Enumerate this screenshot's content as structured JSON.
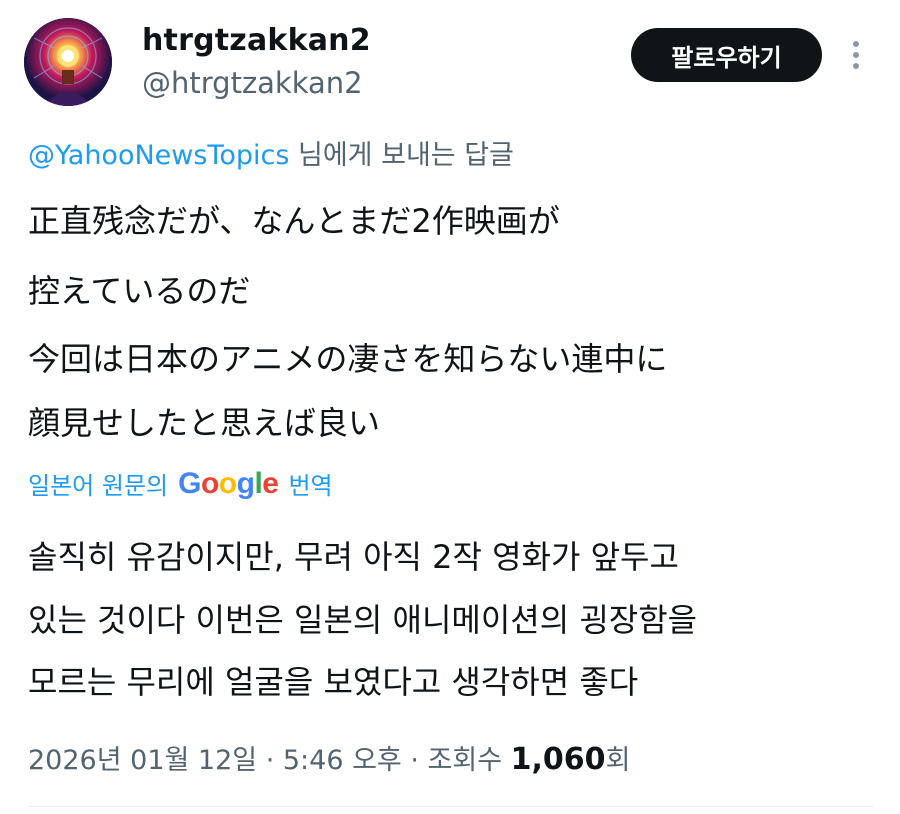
{
  "author": {
    "display_name": "htrgtzakkan2",
    "handle": "@htrgtzakkan2",
    "avatar_icon": "glowing-lantern-avatar"
  },
  "actions": {
    "follow_label": "팔로우하기",
    "more_icon": "more-vertical-icon"
  },
  "reply_context": {
    "mention": "@YahooNewsTopics",
    "suffix": "님에게 보내는 답글"
  },
  "tweet": {
    "original_lines": [
      "正直残念だが、なんとまだ2作映画が",
      "控えているのだ",
      "今回は日本のアニメの凄さを知らない連中に",
      "顔見せしたと思えば良い"
    ],
    "translation_lines": [
      "솔직히 유감이지만, 무려 아직 2작 영화가 앞두고",
      "있는 것이다 이번은 일본의 애니메이션의 굉장함을",
      "모르는 무리에 얼굴을 보였다고 생각하면 좋다"
    ]
  },
  "translation_bar": {
    "prefix": "일본어 원문의",
    "google_letters": [
      "G",
      "o",
      "o",
      "g",
      "l",
      "e"
    ],
    "google_colors": [
      "#4285F4",
      "#EA4335",
      "#FBBC05",
      "#4285F4",
      "#34A853",
      "#EA4335"
    ],
    "suffix": "번역"
  },
  "meta": {
    "date": "2026년 01월 12일",
    "separator": " · ",
    "time": "5:46 오후",
    "views_label": "조회수",
    "views_count": "1,060",
    "views_unit": "회"
  },
  "colors": {
    "accent": "#1d9bf0",
    "text": "#0f1419",
    "secondary": "#536471",
    "button_bg": "#0f1419"
  }
}
